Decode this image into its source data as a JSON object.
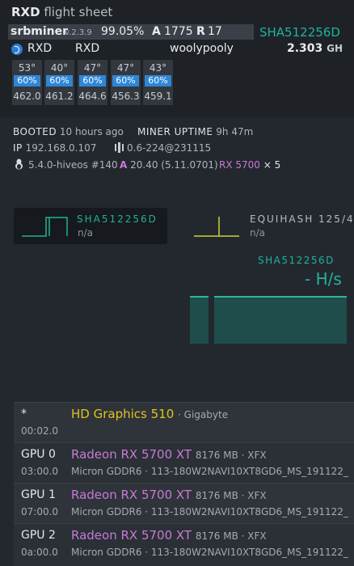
{
  "header": {
    "coin": "RXD",
    "title_suffix": "flight sheet"
  },
  "miner": {
    "name": "srbminer",
    "version": "v.2.3.9",
    "efficiency": "99.05%",
    "accepted_label": "A",
    "accepted": "1775",
    "rejected_label": "R",
    "rejected": "17",
    "algo": "SHA512256D"
  },
  "wallet": {
    "coin": "RXD",
    "wallet": "RXD",
    "pool": "woolypooly",
    "hashrate": "2.303",
    "unit": "GH"
  },
  "gpus": [
    {
      "temp": "53°",
      "fan": "60%",
      "hashrate": "462.0"
    },
    {
      "temp": "40°",
      "fan": "60%",
      "hashrate": "461.2"
    },
    {
      "temp": "47°",
      "fan": "60%",
      "hashrate": "464.6"
    },
    {
      "temp": "47°",
      "fan": "60%",
      "hashrate": "456.3"
    },
    {
      "temp": "43°",
      "fan": "60%",
      "hashrate": "459.1"
    }
  ],
  "status": {
    "booted_label": "BOOTED",
    "booted_value": "10 hours ago",
    "uptime_label": "MINER UPTIME",
    "uptime_value": "9h 47m",
    "ip_label": "IP",
    "ip_value": "192.168.0.107",
    "hive_version": "0.6-224@231115",
    "kernel": "5.4.0-hiveos #140",
    "amd_label": "A",
    "amd_driver": "20.40 (5.11.0701)",
    "gpu_model": "RX 5700",
    "gpu_count": "× 5"
  },
  "graphs": {
    "card1_algo": "SHA512256D",
    "card1_sub": "n/a",
    "card2_algo": "EQUIHASH 125/4",
    "card2_sub": "n/a",
    "right_algo": "SHA512256D",
    "right_hashrate": "- H/s"
  },
  "devices": [
    {
      "id": "*",
      "bus": "00:02.0",
      "name": "HD Graphics 510",
      "meta": "· Gigabyte",
      "mem": ""
    },
    {
      "id": "GPU 0",
      "bus": "03:00.0",
      "name": "Radeon RX 5700 XT",
      "meta": "8176 MB · XFX",
      "mem": "Micron GDDR6 · 113-180W2NAVI10XT8GD6_MS_191122_"
    },
    {
      "id": "GPU 1",
      "bus": "07:00.0",
      "name": "Radeon RX 5700 XT",
      "meta": "8176 MB · XFX",
      "mem": "Micron GDDR6 · 113-180W2NAVI10XT8GD6_MS_191122_"
    },
    {
      "id": "GPU 2",
      "bus": "0a:00.0",
      "name": "Radeon RX 5700 XT",
      "meta": "8176 MB · XFX",
      "mem": "Micron GDDR6 · 113-180W2NAVI10XT8GD6_MS_191122_"
    }
  ],
  "colors": {
    "accent_green": "#1fb39a",
    "fan_blue": "#2e86d6",
    "intel_yellow": "#e3c21b",
    "amd_purple": "#c77ad6",
    "equihash_yellow": "#c9d23a"
  }
}
